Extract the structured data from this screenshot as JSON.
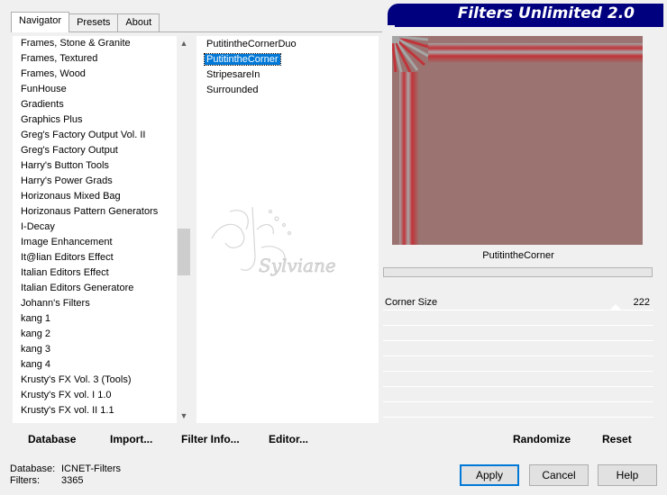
{
  "tabs": [
    {
      "label": "Navigator"
    },
    {
      "label": "Presets"
    },
    {
      "label": "About"
    }
  ],
  "banner": {
    "title": "Filters Unlimited 2.0"
  },
  "categories": [
    "Frames, Stone & Granite",
    "Frames, Textured",
    "Frames, Wood",
    "FunHouse",
    "Gradients",
    "Graphics Plus",
    "Greg's Factory Output Vol. II",
    "Greg's Factory Output",
    "Harry's Button Tools",
    "Harry's Power Grads",
    "Horizonaus Mixed Bag",
    "Horizonaus Pattern Generators",
    "I-Decay",
    "Image Enhancement",
    "It@lian Editors Effect",
    "Italian Editors Effect",
    "Italian Editors Generatore",
    "Johann's Filters",
    "kang 1",
    "kang 2",
    "kang 3",
    "kang 4",
    "Krusty's FX Vol. 3 (Tools)",
    "Krusty's FX vol. I 1.0",
    "Krusty's FX vol. II 1.1"
  ],
  "filters": [
    {
      "label": "PutitintheCornerDuo",
      "selected": false
    },
    {
      "label": "PutitintheCorner",
      "selected": true
    },
    {
      "label": "StripesareIn",
      "selected": false
    },
    {
      "label": "Surrounded",
      "selected": false
    }
  ],
  "preview": {
    "effect_name": "PutitintheCorner",
    "colors": {
      "base": "#9b7370",
      "stripe_red": "#c0343a",
      "stripe_gray": "#a5a5a5"
    }
  },
  "params": [
    {
      "label": "Corner Size",
      "value": "222"
    }
  ],
  "toolbar": {
    "database": "Database",
    "import": "Import...",
    "filter_info": "Filter Info...",
    "editor": "Editor...",
    "randomize": "Randomize",
    "reset": "Reset"
  },
  "status": {
    "database_label": "Database:",
    "database_value": "ICNET-Filters",
    "filters_label": "Filters:",
    "filters_value": "3365"
  },
  "buttons": {
    "apply": "Apply",
    "cancel": "Cancel",
    "help": "Help"
  },
  "watermark": {
    "text": "Sylviane"
  }
}
